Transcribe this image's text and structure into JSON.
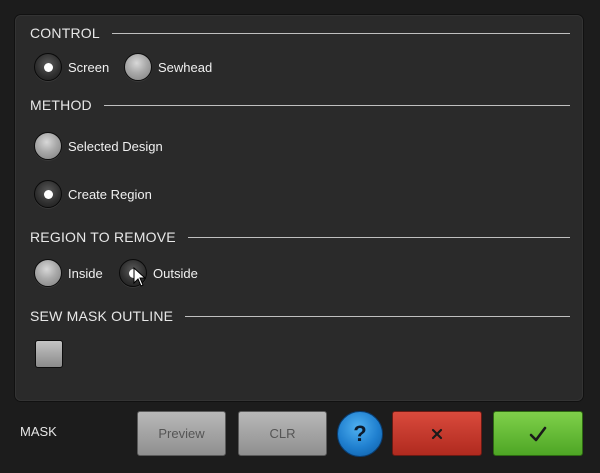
{
  "sections": {
    "control": {
      "title": "CONTROL",
      "options": [
        {
          "label": "Screen",
          "selected": true
        },
        {
          "label": "Sewhead",
          "selected": false
        }
      ]
    },
    "method": {
      "title": "METHOD",
      "options": [
        {
          "label": "Selected Design",
          "selected": false
        },
        {
          "label": "Create Region",
          "selected": true
        }
      ]
    },
    "region": {
      "title": "REGION TO REMOVE",
      "options": [
        {
          "label": "Inside",
          "selected": false
        },
        {
          "label": "Outside",
          "selected": true
        }
      ]
    },
    "sew_mask": {
      "title": "SEW MASK OUTLINE",
      "checked": false
    }
  },
  "footer": {
    "title": "MASK",
    "preview_label": "Preview",
    "clear_label": "CLR",
    "help_label": "?",
    "cancel_icon": "x-icon",
    "ok_icon": "checkmark-icon"
  },
  "colors": {
    "cancel": "#c0392b",
    "ok": "#5cb82e",
    "help": "#1f7fcf"
  }
}
